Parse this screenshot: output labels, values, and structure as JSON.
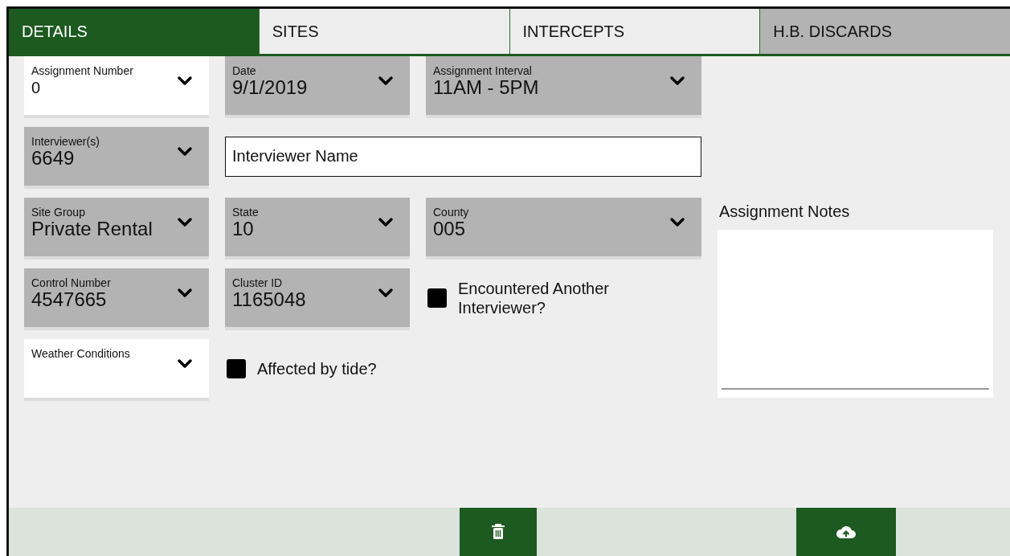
{
  "tabs": [
    {
      "label": "DETAILS",
      "selected": true,
      "disabled": false
    },
    {
      "label": "SITES",
      "selected": false,
      "disabled": false
    },
    {
      "label": "INTERCEPTS",
      "selected": false,
      "disabled": false
    },
    {
      "label": "H.B. DISCARDS",
      "selected": false,
      "disabled": true
    }
  ],
  "form_rows": [
    [
      {
        "kind": "dropdown",
        "label": "Assignment Number",
        "value": "0",
        "disabled": false
      },
      {
        "kind": "dropdown",
        "label": "Date",
        "value": "9/1/2019",
        "disabled": true
      },
      {
        "kind": "dropdown",
        "label": "Assignment Interval",
        "value": "11AM - 5PM",
        "disabled": true
      }
    ],
    [
      {
        "kind": "dropdown",
        "label": "Interviewer(s)",
        "value": "6649",
        "disabled": true
      },
      {
        "kind": "text",
        "value": "Interviewer Name"
      }
    ],
    [
      {
        "kind": "dropdown",
        "label": "Site Group",
        "value": "Private Rental",
        "disabled": true
      },
      {
        "kind": "dropdown",
        "label": "State",
        "value": "10",
        "disabled": true
      },
      {
        "kind": "dropdown",
        "label": "County",
        "value": "005",
        "disabled": true
      }
    ],
    [
      {
        "kind": "dropdown",
        "label": "Control Number",
        "value": "4547665",
        "disabled": true
      },
      {
        "kind": "dropdown",
        "label": "Cluster ID",
        "value": "1165048",
        "disabled": true
      },
      {
        "kind": "checkbox",
        "label": "Encountered Another Interviewer?",
        "checked": false
      }
    ],
    [
      {
        "kind": "dropdown",
        "label": "Weather Conditions",
        "disabled": false
      },
      {
        "kind": "checkbox",
        "label": "Affected by tide?",
        "checked": false
      }
    ]
  ],
  "notes": {
    "label": "Assignment Notes"
  },
  "footer_buttons": [
    {
      "kind": "delete"
    },
    {
      "kind": "upload"
    }
  ]
}
